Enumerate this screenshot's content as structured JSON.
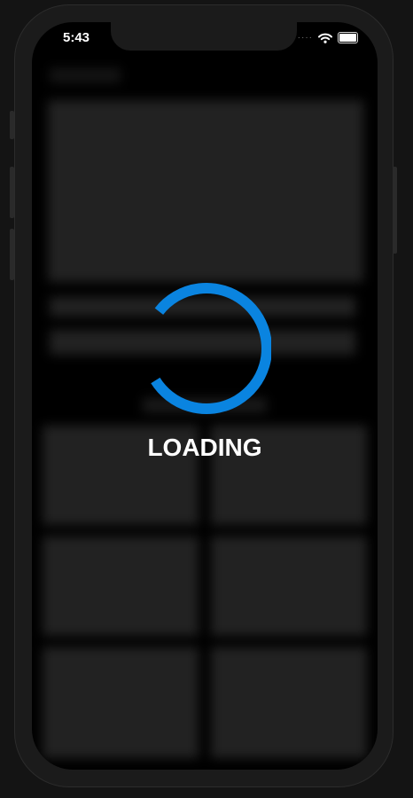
{
  "status_bar": {
    "time": "5:43",
    "signal_icon": "signal-dots-icon",
    "wifi_icon": "wifi-icon",
    "battery_icon": "battery-icon"
  },
  "loader": {
    "label": "LOADING",
    "color": "#0a84e0"
  }
}
